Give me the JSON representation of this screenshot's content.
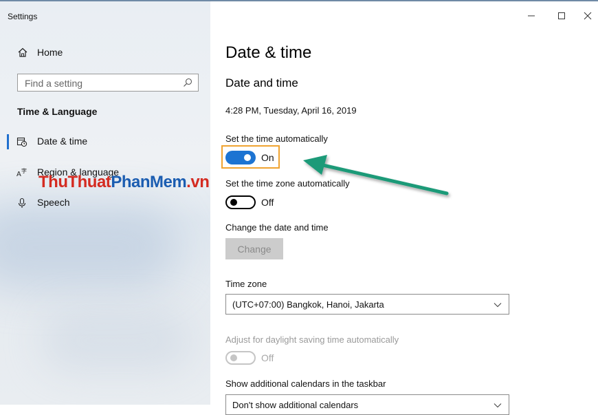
{
  "window": {
    "title": "Settings"
  },
  "sidebar": {
    "home_label": "Home",
    "search_placeholder": "Find a setting",
    "section_title": "Time & Language",
    "items": [
      {
        "label": "Date & time",
        "icon": "date-time-icon",
        "selected": true
      },
      {
        "label": "Region & language",
        "icon": "region-language-icon",
        "selected": false
      },
      {
        "label": "Speech",
        "icon": "microphone-icon",
        "selected": false
      }
    ]
  },
  "watermark": {
    "part1": "ThuThuat",
    "part2": "PhanMem",
    "part3": ".vn"
  },
  "content": {
    "page_title": "Date & time",
    "section_title": "Date and time",
    "current_datetime": "4:28 PM, Tuesday, April 16, 2019",
    "auto_time": {
      "label": "Set the time automatically",
      "state": "On"
    },
    "auto_timezone": {
      "label": "Set the time zone automatically",
      "state": "Off"
    },
    "change_datetime": {
      "label": "Change the date and time",
      "button": "Change"
    },
    "timezone": {
      "label": "Time zone",
      "value": "(UTC+07:00) Bangkok, Hanoi, Jakarta"
    },
    "daylight": {
      "label": "Adjust for daylight saving time automatically",
      "state": "Off"
    },
    "calendars": {
      "label": "Show additional calendars in the taskbar",
      "value": "Don't show additional calendars"
    }
  },
  "colors": {
    "accent": "#1d74d2",
    "highlight_border": "#f0a330",
    "arrow": "#1a9a78",
    "watermark_red": "#d42b21",
    "watermark_blue": "#1b5db1"
  }
}
